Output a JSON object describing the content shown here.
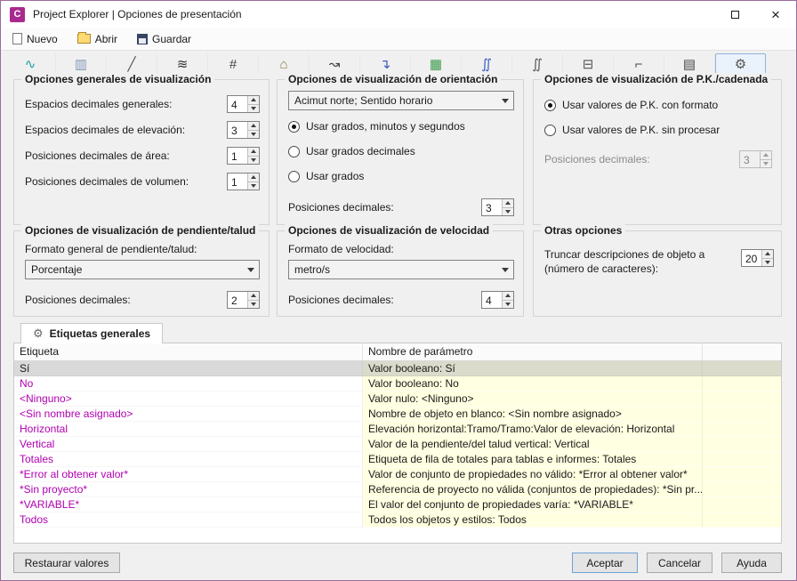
{
  "window": {
    "title": "Project Explorer | Opciones de presentación",
    "icon_letter": "C"
  },
  "toolbar": {
    "new_label": "Nuevo",
    "open_label": "Abrir",
    "save_label": "Guardar"
  },
  "tabstrip": {
    "icons": [
      {
        "name": "alignments-icon",
        "glyph": "∿",
        "color": "#1f9e9e",
        "selected": false
      },
      {
        "name": "profile-views-icon",
        "glyph": "▥",
        "color": "#7d96b8",
        "selected": false
      },
      {
        "name": "profiles-icon",
        "glyph": "╱",
        "color": "#555555",
        "selected": false
      },
      {
        "name": "corridors-icon",
        "glyph": "≋",
        "color": "#333333",
        "selected": false
      },
      {
        "name": "parcels-icon",
        "glyph": "#",
        "color": "#444444",
        "selected": false
      },
      {
        "name": "grading-icon",
        "glyph": "⌂",
        "color": "#8a7a4a",
        "selected": false
      },
      {
        "name": "feature-lines-icon",
        "glyph": "↝",
        "color": "#444444",
        "selected": false
      },
      {
        "name": "pipe-networks-icon",
        "glyph": "↴",
        "color": "#3a5bc0",
        "selected": false
      },
      {
        "name": "pressure-networks-icon",
        "glyph": "▦",
        "color": "#3a9a4a",
        "selected": false
      },
      {
        "name": "labels-icon",
        "glyph": "∬",
        "color": "#3a5bc0",
        "selected": false
      },
      {
        "name": "expressions-icon",
        "glyph": "∬",
        "color": "#555555",
        "selected": false
      },
      {
        "name": "survey-icon",
        "glyph": "⊟",
        "color": "#555555",
        "selected": false
      },
      {
        "name": "structures-icon",
        "glyph": "⌐",
        "color": "#444444",
        "selected": false
      },
      {
        "name": "reports-icon",
        "glyph": "▤",
        "color": "#444444",
        "selected": false
      },
      {
        "name": "settings-icon",
        "glyph": "⚙",
        "color": "#555555",
        "selected": true
      }
    ]
  },
  "groups": {
    "general": {
      "title": "Opciones generales de visualización",
      "fields": [
        {
          "label": "Espacios decimales generales:",
          "value": "4"
        },
        {
          "label": "Espacios decimales de elevación:",
          "value": "3"
        },
        {
          "label": "Posiciones decimales de área:",
          "value": "1"
        },
        {
          "label": "Posiciones decimales de volumen:",
          "value": "1"
        }
      ]
    },
    "orientation": {
      "title": "Opciones de visualización de orientación",
      "dropdown_value": "Acimut norte; Sentido horario",
      "radios": [
        {
          "label": "Usar grados, minutos y segundos",
          "checked": true
        },
        {
          "label": "Usar grados decimales",
          "checked": false
        },
        {
          "label": "Usar grados",
          "checked": false
        }
      ],
      "decimals_label": "Posiciones decimales:",
      "decimals_value": "3"
    },
    "station": {
      "title": "Opciones de visualización de P.K./cadenada",
      "radios": [
        {
          "label": "Usar valores de P.K. con formato",
          "checked": true
        },
        {
          "label": "Usar valores de P.K. sin procesar",
          "checked": false
        }
      ],
      "decimals_label": "Posiciones decimales:",
      "decimals_value": "3"
    },
    "slope": {
      "title": "Opciones de visualización de pendiente/talud",
      "format_label": "Formato general de pendiente/talud:",
      "dropdown_value": "Porcentaje",
      "decimals_label": "Posiciones decimales:",
      "decimals_value": "2"
    },
    "speed": {
      "title": "Opciones de visualización de velocidad",
      "format_label": "Formato de velocidad:",
      "dropdown_value": "metro/s",
      "decimals_label": "Posiciones decimales:",
      "decimals_value": "4"
    },
    "other": {
      "title": "Otras opciones",
      "truncate_label": "Truncar descripciones de objeto a (número de caracteres):",
      "truncate_value": "20"
    }
  },
  "labels_tab": {
    "label": "Etiquetas generales",
    "glyph": "⚙"
  },
  "table": {
    "columns": [
      "Etiqueta",
      "Nombre de parámetro"
    ],
    "rows": [
      {
        "etiqueta": "Sí",
        "parametro": "Valor booleano: Sí",
        "selected": true
      },
      {
        "etiqueta": "No",
        "parametro": "Valor booleano: No",
        "selected": false
      },
      {
        "etiqueta": "<Ninguno>",
        "parametro": "Valor nulo: <Ninguno>",
        "selected": false
      },
      {
        "etiqueta": "<Sin nombre asignado>",
        "parametro": "Nombre de objeto en blanco: <Sin nombre asignado>",
        "selected": false
      },
      {
        "etiqueta": "Horizontal",
        "parametro": "Elevación horizontal:Tramo/Tramo:Valor de elevación: Horizontal",
        "selected": false
      },
      {
        "etiqueta": "Vertical",
        "parametro": "Valor de la pendiente/del talud vertical: Vertical",
        "selected": false
      },
      {
        "etiqueta": "Totales",
        "parametro": "Etiqueta de fila de totales para tablas e informes: Totales",
        "selected": false
      },
      {
        "etiqueta": "*Error al obtener valor*",
        "parametro": "Valor de conjunto de propiedades no válido: *Error al obtener valor*",
        "selected": false
      },
      {
        "etiqueta": "*Sin proyecto*",
        "parametro": "Referencia de proyecto no válida (conjuntos de propiedades): *Sin pr...",
        "selected": false
      },
      {
        "etiqueta": "*VARIABLE*",
        "parametro": "El valor del conjunto de propiedades varía: *VARIABLE*",
        "selected": false
      },
      {
        "etiqueta": "Todos",
        "parametro": "Todos los objetos y estilos: Todos",
        "selected": false
      }
    ]
  },
  "footer": {
    "restore_label": "Restaurar valores",
    "accept_label": "Aceptar",
    "cancel_label": "Cancelar",
    "help_label": "Ayuda"
  },
  "colors": {
    "accent_magenta": "#b000b0",
    "param_bg": "#ffffe1",
    "selection": "#d9d9d9"
  }
}
